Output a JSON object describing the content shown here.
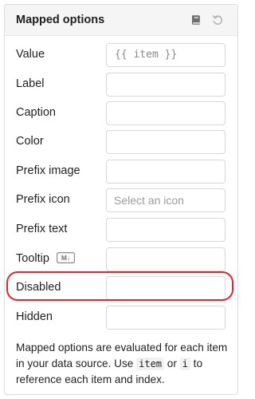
{
  "panel": {
    "title": "Mapped options",
    "docs_icon": "book-icon",
    "reset_icon": "reset-icon"
  },
  "fields": {
    "value": {
      "label": "Value",
      "value": "{{ item }}"
    },
    "label": {
      "label": "Label",
      "value": ""
    },
    "caption": {
      "label": "Caption",
      "value": ""
    },
    "color": {
      "label": "Color",
      "value": ""
    },
    "prefix_image": {
      "label": "Prefix image",
      "value": ""
    },
    "prefix_icon": {
      "label": "Prefix icon",
      "placeholder": "Select an icon"
    },
    "prefix_text": {
      "label": "Prefix text",
      "value": ""
    },
    "tooltip": {
      "label": "Tooltip",
      "badge": "M↓",
      "value": ""
    },
    "disabled": {
      "label": "Disabled",
      "value": ""
    },
    "hidden": {
      "label": "Hidden",
      "value": ""
    }
  },
  "footer": {
    "text_1": "Mapped options are evaluated for each item in your data source. Use ",
    "code_1": "item",
    "text_2": " or ",
    "code_2": "i",
    "text_3": " to reference each item and index."
  },
  "colors": {
    "highlight": "#e0262a",
    "header_bg": "#f5f5f5",
    "border": "#d7d7d7"
  }
}
